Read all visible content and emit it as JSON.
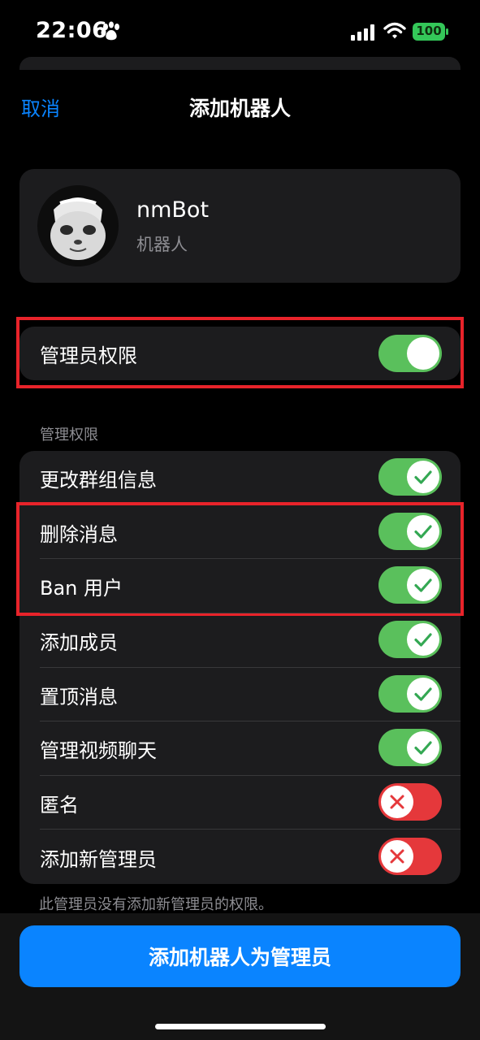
{
  "status_bar": {
    "time": "22:06",
    "battery": "100",
    "icons": [
      "paw-icon",
      "signal-icon",
      "wifi-icon",
      "battery-icon"
    ]
  },
  "nav": {
    "cancel_label": "取消",
    "title": "添加机器人"
  },
  "bot": {
    "name": "nmBot",
    "subtitle": "机器人"
  },
  "admin_toggle": {
    "label": "管理员权限",
    "on": true
  },
  "permissions": {
    "header": "管理权限",
    "items": [
      {
        "label": "更改群组信息",
        "on": true
      },
      {
        "label": "删除消息",
        "on": true
      },
      {
        "label": "Ban 用户",
        "on": true
      },
      {
        "label": "添加成员",
        "on": true
      },
      {
        "label": "置顶消息",
        "on": true
      },
      {
        "label": "管理视频聊天",
        "on": true
      },
      {
        "label": "匿名",
        "on": false
      },
      {
        "label": "添加新管理员",
        "on": false
      }
    ],
    "footer_note": "此管理员没有添加新管理员的权限。"
  },
  "primary_button": {
    "label": "添加机器人为管理员"
  },
  "colors": {
    "accent": "#0a84ff",
    "toggle_on": "#5ac05c",
    "toggle_off": "#e5383b",
    "highlight_box": "#e8232a"
  }
}
